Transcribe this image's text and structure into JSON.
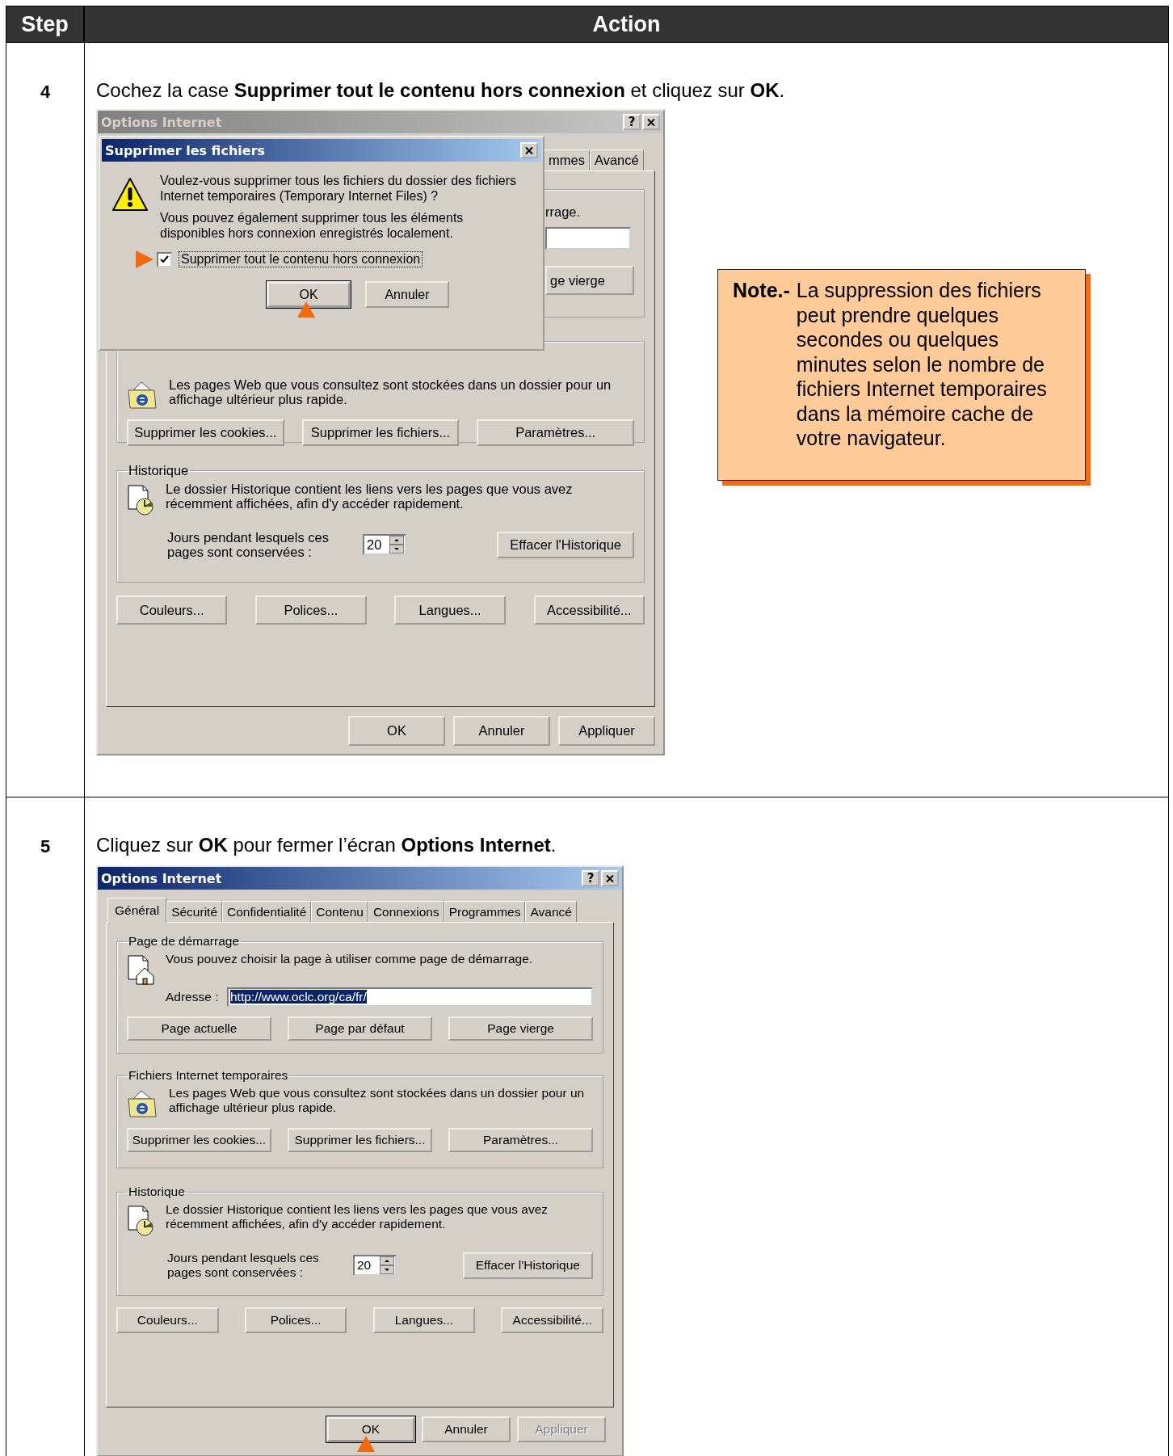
{
  "header": {
    "step": "Step",
    "action": "Action"
  },
  "steps": [
    {
      "number": "4",
      "instruction": "Cochez la case **Supprimer tout le contenu hors connexion** et cliquez sur **OK**.",
      "window": {
        "kind": "covered",
        "title": "Options Internet",
        "active": false,
        "help": "?",
        "tabs": [
          {
            "label": "mmes",
            "selected": false
          },
          {
            "label": "Avancé",
            "selected": false
          }
        ],
        "start_page": {
          "text": "rrage.",
          "buttons": [
            "ge vierge"
          ]
        },
        "temp_files": {
          "text": "Les pages Web que vous consultez sont stockées dans un dossier pour un affichage ultérieur plus rapide.",
          "buttons": [
            "Supprimer les cookies...",
            "Supprimer les fichiers...",
            "Paramètres..."
          ]
        },
        "history": {
          "title": "Historique",
          "text": "Le dossier Historique contient les liens vers les pages que vous avez récemment affichées, afin d'y accéder rapidement.",
          "days_label": "Jours pendant lesquels ces pages sont conservées :",
          "days": "20",
          "clear_button": "Effacer l'Historique"
        },
        "extra_buttons": [
          "Couleurs...",
          "Polices...",
          "Langues...",
          "Accessibilité..."
        ],
        "footer_buttons": [
          {
            "label": "OK",
            "default": false,
            "disabled": false,
            "pointed": false
          },
          {
            "label": "Annuler",
            "default": false,
            "disabled": false,
            "pointed": false
          },
          {
            "label": "Appliquer",
            "default": false,
            "disabled": false,
            "pointed": false
          }
        ],
        "popup": {
          "title": "Supprimer les fichiers",
          "message": "Voulez-vous supprimer tous les fichiers du dossier des fichiers Internet temporaires (Temporary Internet Files) ?",
          "detail": "Vous pouvez également supprimer tous les éléments disponibles hors connexion enregistrés localement.",
          "checkbox": {
            "label": "Supprimer tout le contenu hors connexion",
            "checked": true,
            "pointed": true
          },
          "buttons": [
            {
              "label": "OK",
              "default": true,
              "pointed": true
            },
            {
              "label": "Annuler",
              "default": false,
              "pointed": false
            }
          ]
        }
      },
      "note": {
        "label": "Note.-",
        "text": "La suppression des fichiers peut prendre quelques secondes ou quelques minutes selon le nombre de fichiers Internet temporaires dans la mémoire cache de votre navigateur."
      }
    },
    {
      "number": "5",
      "instruction": "Cliquez sur **OK** pour fermer l’écran **Options Internet**.",
      "window": {
        "kind": "full",
        "title": "Options Internet",
        "active": true,
        "help": "?",
        "tabs": [
          {
            "label": "Général",
            "selected": true
          },
          {
            "label": "Sécurité",
            "selected": false
          },
          {
            "label": "Confidentialité",
            "selected": false
          },
          {
            "label": "Contenu",
            "selected": false
          },
          {
            "label": "Connexions",
            "selected": false
          },
          {
            "label": "Programmes",
            "selected": false
          },
          {
            "label": "Avancé",
            "selected": false
          }
        ],
        "start_page": {
          "title": "Page de démarrage",
          "text": "Vous pouvez choisir la page à utiliser comme page de démarrage.",
          "address_label": "Adresse :",
          "address": "http://www.oclc.org/ca/fr/",
          "address_selected": true,
          "buttons": [
            "Page actuelle",
            "Page par défaut",
            "Page vierge"
          ]
        },
        "temp_files": {
          "title": "Fichiers Internet temporaires",
          "text": "Les pages Web que vous consultez sont stockées dans un dossier pour un affichage ultérieur plus rapide.",
          "buttons": [
            "Supprimer les cookies...",
            "Supprimer les fichiers...",
            "Paramètres..."
          ]
        },
        "history": {
          "title": "Historique",
          "text": "Le dossier Historique contient les liens vers les pages que vous avez récemment affichées, afin d'y accéder rapidement.",
          "days_label": "Jours pendant lesquels ces pages sont conservées :",
          "days": "20",
          "clear_button": "Effacer l'Historique"
        },
        "extra_buttons": [
          "Couleurs...",
          "Polices...",
          "Langues...",
          "Accessibilité..."
        ],
        "footer_buttons": [
          {
            "label": "OK",
            "default": true,
            "disabled": false,
            "pointed": true
          },
          {
            "label": "Annuler",
            "default": false,
            "disabled": false,
            "pointed": false
          },
          {
            "label": "Appliquer",
            "default": false,
            "disabled": true,
            "pointed": false
          }
        ]
      }
    }
  ]
}
